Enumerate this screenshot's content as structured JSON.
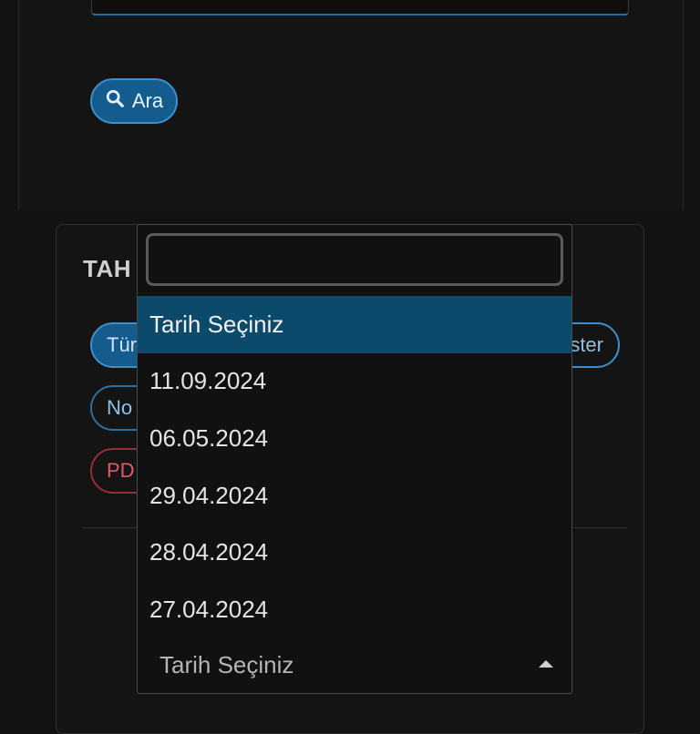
{
  "search": {
    "button_label": "Ara",
    "icon": "search-icon"
  },
  "card": {
    "title": "TAH",
    "pills": [
      {
        "label": "Tür",
        "style": "filled-blue"
      },
      {
        "label": "ster",
        "style": "outline-blue"
      },
      {
        "label": "No",
        "style": "outline-blue"
      },
      {
        "label": "PD",
        "style": "outline-red"
      }
    ]
  },
  "dropdown": {
    "search_value": "",
    "options": [
      {
        "label": "Tarih Seçiniz",
        "selected": true
      },
      {
        "label": "11.09.2024",
        "selected": false
      },
      {
        "label": "06.05.2024",
        "selected": false
      },
      {
        "label": "29.04.2024",
        "selected": false
      },
      {
        "label": "28.04.2024",
        "selected": false
      },
      {
        "label": "27.04.2024",
        "selected": false
      }
    ],
    "selected_display": "Tarih Seçiniz",
    "caret_icon": "caret-up-icon"
  },
  "colors": {
    "background": "#121212",
    "accent_blue": "#155c8e",
    "accent_border": "#3d8fcc",
    "selected_option": "#0b4a6b",
    "danger": "#9a2a3a"
  }
}
